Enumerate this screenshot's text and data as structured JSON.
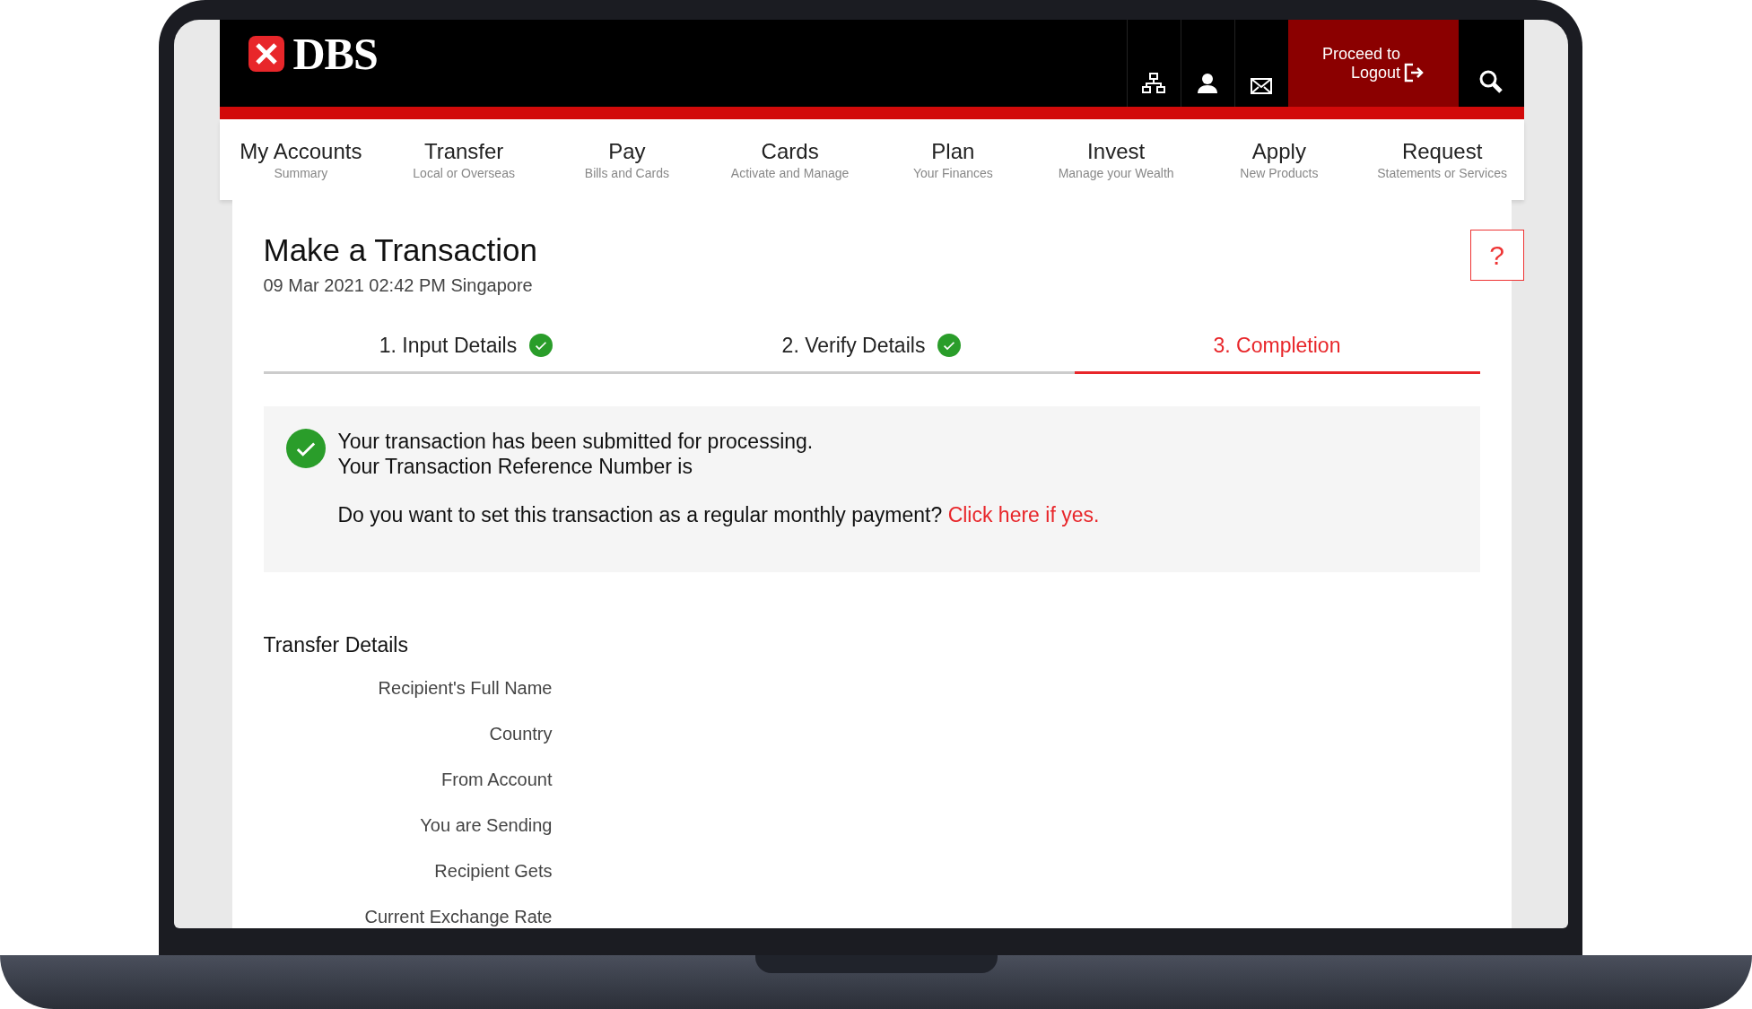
{
  "header": {
    "logo": "DBS",
    "logout": {
      "line1": "Proceed to",
      "line2": "Logout"
    }
  },
  "nav": [
    {
      "title": "My Accounts",
      "subtitle": "Summary"
    },
    {
      "title": "Transfer",
      "subtitle": "Local or Overseas"
    },
    {
      "title": "Pay",
      "subtitle": "Bills and Cards"
    },
    {
      "title": "Cards",
      "subtitle": "Activate and Manage"
    },
    {
      "title": "Plan",
      "subtitle": "Your Finances"
    },
    {
      "title": "Invest",
      "subtitle": "Manage your Wealth"
    },
    {
      "title": "Apply",
      "subtitle": "New Products"
    },
    {
      "title": "Request",
      "subtitle": "Statements or Services"
    }
  ],
  "page": {
    "title": "Make a Transaction",
    "datetime": "09 Mar 2021 02:42 PM Singapore",
    "help": "?"
  },
  "steps": [
    {
      "label": "1. Input Details",
      "completed": true,
      "selected": false
    },
    {
      "label": "2. Verify Details",
      "completed": true,
      "selected": false
    },
    {
      "label": "3. Completion",
      "completed": false,
      "selected": true
    }
  ],
  "confirmation": {
    "line1": "Your transaction has been submitted for processing.",
    "line2": "Your Transaction Reference Number is",
    "question": "Do you want to set this transaction as a regular monthly payment?",
    "link": "Click here if yes."
  },
  "transfer_details": {
    "title": "Transfer Details",
    "fields": [
      "Recipient's Full Name",
      "Country",
      "From Account",
      "You are Sending",
      "Recipient Gets",
      "Current Exchange Rate"
    ]
  }
}
